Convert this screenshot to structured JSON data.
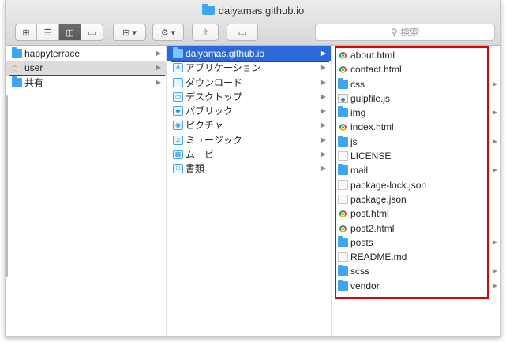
{
  "window": {
    "title": "daiyamas.github.io",
    "search_placeholder": "検索"
  },
  "toolbar": {
    "view_icons": [
      "icon-view-icon",
      "list-view-icon",
      "column-view-icon",
      "coverflow-view-icon"
    ],
    "arrange_icon": "arrange-icon",
    "action_icon": "gear-icon",
    "share_icon": "share-icon",
    "tag_icon": "tag-icon"
  },
  "column1": {
    "items": [
      {
        "label": "happyterrace",
        "icon": "folder-icon",
        "has_children": true
      },
      {
        "label": "user",
        "icon": "home-icon",
        "has_children": true,
        "selected": true
      },
      {
        "label": "共有",
        "icon": "folder-icon",
        "has_children": true
      }
    ]
  },
  "column2": {
    "items": [
      {
        "label": "daiyamas.github.io",
        "icon": "folder-icon",
        "has_children": true,
        "selected": true
      },
      {
        "label": "アプリケーション",
        "icon": "applications-folder-icon",
        "has_children": true
      },
      {
        "label": "ダウンロード",
        "icon": "downloads-folder-icon",
        "has_children": true
      },
      {
        "label": "デスクトップ",
        "icon": "desktop-folder-icon",
        "has_children": true
      },
      {
        "label": "パブリック",
        "icon": "public-folder-icon",
        "has_children": true
      },
      {
        "label": "ピクチャ",
        "icon": "pictures-folder-icon",
        "has_children": true
      },
      {
        "label": "ミュージック",
        "icon": "music-folder-icon",
        "has_children": true
      },
      {
        "label": "ムービー",
        "icon": "movies-folder-icon",
        "has_children": true
      },
      {
        "label": "書類",
        "icon": "documents-folder-icon",
        "has_children": true
      }
    ]
  },
  "column3": {
    "items": [
      {
        "label": "about.html",
        "icon": "chrome-html-icon",
        "has_children": false
      },
      {
        "label": "contact.html",
        "icon": "chrome-html-icon",
        "has_children": false
      },
      {
        "label": "css",
        "icon": "folder-icon",
        "has_children": true
      },
      {
        "label": "gulpfile.js",
        "icon": "js-file-icon",
        "has_children": false
      },
      {
        "label": "img",
        "icon": "folder-icon",
        "has_children": true
      },
      {
        "label": "index.html",
        "icon": "chrome-html-icon",
        "has_children": false
      },
      {
        "label": "js",
        "icon": "folder-icon",
        "has_children": true
      },
      {
        "label": "LICENSE",
        "icon": "document-icon",
        "has_children": false
      },
      {
        "label": "mail",
        "icon": "folder-icon",
        "has_children": true
      },
      {
        "label": "package-lock.json",
        "icon": "document-icon",
        "has_children": false
      },
      {
        "label": "package.json",
        "icon": "document-icon",
        "has_children": false
      },
      {
        "label": "post.html",
        "icon": "chrome-html-icon",
        "has_children": false
      },
      {
        "label": "post2.html",
        "icon": "chrome-html-icon",
        "has_children": false
      },
      {
        "label": "posts",
        "icon": "folder-icon",
        "has_children": true
      },
      {
        "label": "README.md",
        "icon": "document-icon",
        "has_children": false
      },
      {
        "label": "scss",
        "icon": "folder-icon",
        "has_children": true
      },
      {
        "label": "vendor",
        "icon": "folder-icon",
        "has_children": true
      }
    ]
  },
  "colors": {
    "selection": "#2a6bd9",
    "folder": "#3fa5f0",
    "annotation_red": "#e00000"
  }
}
